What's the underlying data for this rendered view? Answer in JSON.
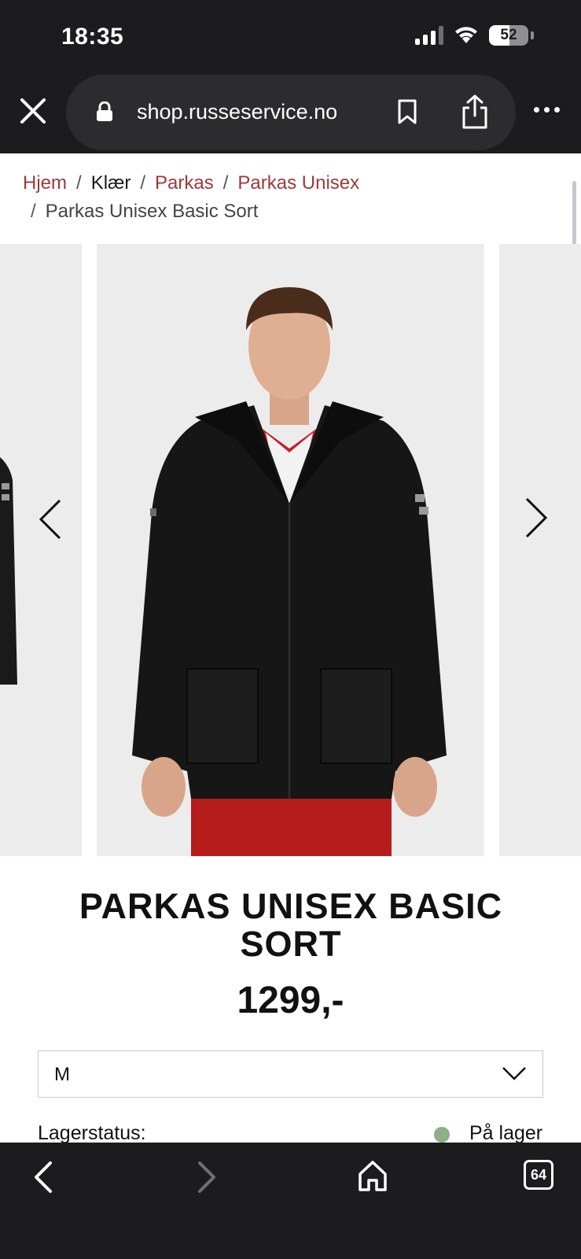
{
  "status": {
    "time": "18:35",
    "battery": "52"
  },
  "browser": {
    "url": "shop.russeservice.no"
  },
  "breadcrumb": {
    "items": [
      "Hjem",
      "Klær",
      "Parkas",
      "Parkas Unisex"
    ],
    "current": "Parkas Unisex Basic Sort",
    "separator": "/"
  },
  "product": {
    "title_line1": "PARKAS UNISEX BASIC",
    "title_line2": "SORT",
    "price": "1299,-",
    "size_selected": "M",
    "stock_label": "Lagerstatus:",
    "stock_value": "På lager",
    "stock_color": "#8fae8a"
  },
  "bottom_bar": {
    "tab_count": "64"
  },
  "colors": {
    "breadcrumb_link": "#9b3a3a",
    "chrome": "#1c1c1e"
  }
}
